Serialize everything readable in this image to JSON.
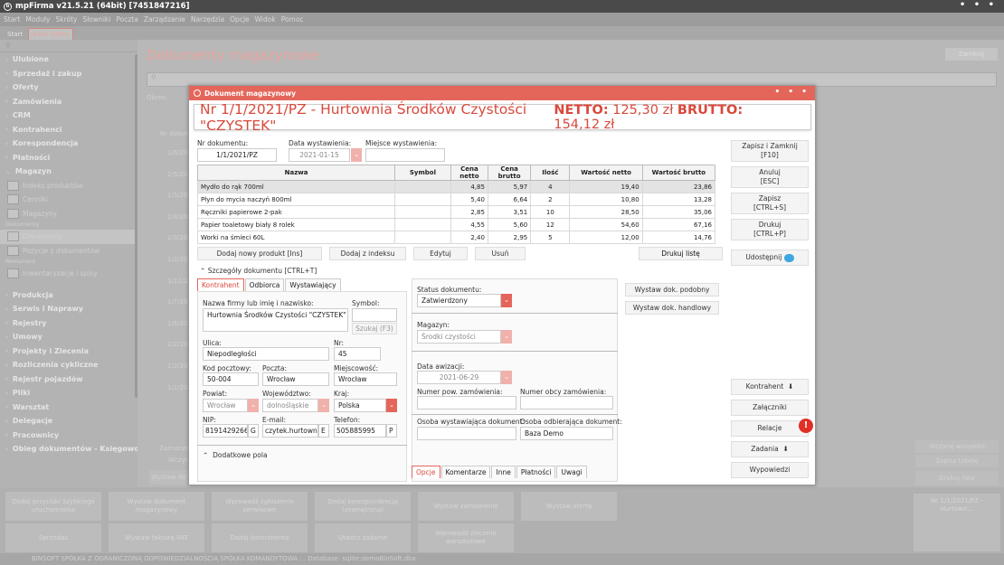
{
  "app": {
    "title": "mpFirma v21.5.21 (64bit) [7451847216]",
    "dots": "• • •"
  },
  "menu": [
    "Start",
    "Moduły",
    "Skróty",
    "Słowniki",
    "Poczta",
    "Zarządzanie",
    "Narzędzia",
    "Opcje",
    "Widok",
    "Pomoc"
  ],
  "top_tabs": [
    "Start",
    "Baza Demo"
  ],
  "sidebar": {
    "search_icon": "search-icon",
    "items_top": [
      "Ulubione",
      "Sprzedaż i zakup",
      "Oferty",
      "Zamówienia",
      "CRM",
      "Kontrahenci",
      "Korespondencja",
      "Płatności",
      "Magazyn"
    ],
    "magazyn_sub": [
      "Indeks produktów",
      "Cenniki",
      "Magazyny"
    ],
    "head_dokumenty": "Dokumenty",
    "dokumenty_sub": [
      "Dokumenty",
      "Pozycje z dokumentów"
    ],
    "head_remanent": "Remanent",
    "remanent_sub": [
      "Inwentaryzacje i spisy"
    ],
    "items_bottom": [
      "Produkcja",
      "Serwis i Naprawy",
      "Rejestry",
      "Umowy",
      "Projekty i Zlecenia",
      "Rozliczenia cykliczne",
      "Rejestr pojazdów",
      "Pliki",
      "Warsztat",
      "Delegacje",
      "Pracownicy",
      "Obieg dokumentów - Księgowość"
    ]
  },
  "background": {
    "title": "Dokumenty magazynowe",
    "close": "Zamknij",
    "okres": "Okres:",
    "col_nr": "Nr dokum",
    "rows": [
      "1/6/202",
      "2/5/202",
      "1/5/202",
      "2/4/202",
      "2/3/202",
      "1/2/202",
      "1/12/20",
      "1/7/202",
      "1/6/202",
      "2/2/202",
      "1/2/202",
      "1/1/202"
    ],
    "zaznaczo": "Zaznaczo",
    "wczyta": "Wczyta",
    "wystaw": "Wystaw do",
    "right_btns": [
      "Wczytaj wszystko",
      "Zapisz tabelę",
      "Drukuj listę"
    ],
    "thumb": "Nr 1/1/2021/PZ - Hurtown..."
  },
  "bottom_tiles": [
    "Dodaj przyciski Szybkiego uruchamiania",
    "Wystaw dokument magazynowy",
    "Wprowadź zgłoszenie serwisowe",
    "Dodaj korespondencję (zewnętrzną)",
    "Wystaw zamówienie",
    "Wystaw ofertę",
    "Sprzedaż",
    "Wystaw fakturę VAT",
    "Dodaj kontrahenta",
    "Utwórz zadanie",
    "Wprowadź zlecenie warsztatowe"
  ],
  "status_bar": "BINSOFT SPÓŁKA Z OGRANICZONĄ ODPOWIEDZIALNOŚCIĄ SPÓŁKA KOMANDYTOWA :.. Database: sqlite:demoBinSoft.dbx",
  "dialog": {
    "title": "Dokument magazynowy",
    "doc_title": "Nr 1/1/2021/PZ - Hurtownia Środków Czystości \"CZYSTEK\"",
    "netto_label": "NETTO:",
    "netto_value": "125,30 zł",
    "brutto_label": "BRUTTO:",
    "brutto_value": "154,12 zł",
    "nr_label": "Nr dokumentu:",
    "nr_value": "1/1/2021/PZ",
    "data_label": "Data wystawienia:",
    "data_value": "2021-01-15",
    "miejsce_label": "Miejsce wystawienia:",
    "miejsce_value": "",
    "columns": [
      "Nazwa",
      "Symbol",
      "Cena netto",
      "Cena brutto",
      "Ilość",
      "Wartość netto",
      "Wartość brutto"
    ],
    "rows": [
      {
        "nazwa": "Mydło do rąk 700ml",
        "symbol": "",
        "netto": "4,85",
        "brutto": "5,97",
        "ilosc": "4",
        "wnetto": "19,40",
        "wbrutto": "23,86"
      },
      {
        "nazwa": "Płyn do mycia naczyń 800ml",
        "symbol": "",
        "netto": "5,40",
        "brutto": "6,64",
        "ilosc": "2",
        "wnetto": "10,80",
        "wbrutto": "13,28"
      },
      {
        "nazwa": "Ręczniki papierowe 2-pak",
        "symbol": "",
        "netto": "2,85",
        "brutto": "3,51",
        "ilosc": "10",
        "wnetto": "28,50",
        "wbrutto": "35,06"
      },
      {
        "nazwa": "Papier toaletowy biały 8 rolek",
        "symbol": "",
        "netto": "4,55",
        "brutto": "5,60",
        "ilosc": "12",
        "wnetto": "54,60",
        "wbrutto": "67,16"
      },
      {
        "nazwa": "Worki na śmieci 60L",
        "symbol": "",
        "netto": "2,40",
        "brutto": "2,95",
        "ilosc": "5",
        "wnetto": "12,00",
        "wbrutto": "14,76"
      }
    ],
    "btn_add": "Dodaj nowy produkt  [Ins]",
    "btn_add_index": "Dodaj z indeksu",
    "btn_edit": "Edytuj",
    "btn_delete": "Usuń",
    "btn_print_list": "Drukuj listę",
    "details": "Szczegóły dokumentu [CTRL+T]",
    "party_tabs": [
      "Kontrahent",
      "Odbiorca",
      "Wystawiający"
    ],
    "firma_label": "Nazwa firmy lub imię i nazwisko:",
    "firma_value": "Hurtownia Środków Czystości \"CZYSTEK\"",
    "symbol_label": "Symbol:",
    "szukaj": "Szukaj (F3)",
    "ulica_label": "Ulica:",
    "ulica_value": "Niepodległości",
    "nr_dom_label": "Nr:",
    "nr_dom_value": "45",
    "kod_label": "Kod pocztowy:",
    "kod_value": "50-004",
    "poczta_label": "Poczta:",
    "poczta_value": "Wrocław",
    "miejsc_label": "Miejscowość:",
    "miejsc_value": "Wrocław",
    "powiat_label": "Powiat:",
    "powiat_value": "Wrocław",
    "woj_label": "Województwo:",
    "woj_value": "dolnośląskie",
    "kraj_label": "Kraj:",
    "kraj_value": "Polska",
    "nip_label": "NIP:",
    "nip_value": "8191429266",
    "nip_g": "G",
    "email_label": "E-mail:",
    "email_value": "czytek.hurtownia@",
    "email_e": "E",
    "tel_label": "Telefon:",
    "tel_value": "505885995",
    "tel_p": "P",
    "dodatkowe": "Dodatkowe pola",
    "status_label": "Status dokumentu:",
    "status_value": "Zatwierdzony",
    "magazyn_label": "Magazyn:",
    "magazyn_value": "Środki czystości",
    "awizacja_label": "Data awizacji:",
    "awizacja_value": "2021-06-29",
    "nr_pow_label": "Numer pow. zamówienia:",
    "nr_obcy_label": "Numer obcy zamówienia:",
    "osoba_wyst_label": "Osoba wystawiająca dokument:",
    "osoba_odb_label": "Osoba odbierająca dokument:",
    "osoba_odb_value": "Baza Demo",
    "bottom_tabs": [
      "Opcje",
      "Komentarze",
      "Inne",
      "Płatności",
      "Uwagi"
    ],
    "btn_similar": "Wystaw dok. podobny",
    "btn_trade": "Wystaw dok. handlowy",
    "right_buttons": {
      "save_close": "Zapisz i Zamknij",
      "save_close_key": "[F10]",
      "cancel": "Anuluj",
      "cancel_key": "[ESC]",
      "save": "Zapisz",
      "save_key": "[CTRL+S]",
      "print": "Drukuj",
      "print_key": "[CTRL+P]",
      "share": "Udostępnij",
      "kontrahent": "Kontrahent",
      "zalaczniki": "Załączniki",
      "relacje": "Relacje",
      "zadania": "Zadania",
      "wypowiedzi": "Wypowiedzi"
    },
    "badge": "!"
  }
}
